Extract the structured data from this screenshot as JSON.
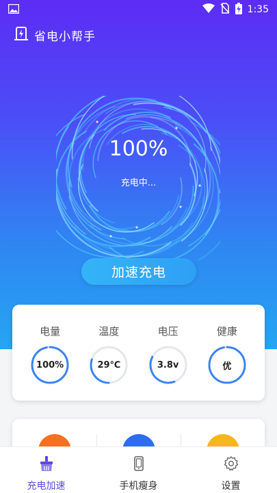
{
  "status_bar": {
    "time": "1:35"
  },
  "app": {
    "title": "省电小帮手"
  },
  "charge": {
    "percent": "100%",
    "status": "充电中..."
  },
  "boost_button": {
    "label": "加速充电"
  },
  "stats": [
    {
      "label": "电量",
      "value": "100%",
      "fraction": 0.97
    },
    {
      "label": "温度",
      "value": "29℃",
      "fraction": 0.3
    },
    {
      "label": "电压",
      "value": "3.8v",
      "fraction": 0.38
    },
    {
      "label": "健康",
      "value": "优",
      "fraction": 0.97
    }
  ],
  "tools": [
    {
      "icon": "rocket-icon",
      "color": "#f6701f"
    },
    {
      "icon": "boost-icon",
      "color": "#2f6df0"
    },
    {
      "icon": "thermometer-icon",
      "color": "#f8b51c"
    }
  ],
  "nav": [
    {
      "label": "充电加速",
      "icon": "broom-icon",
      "active": true
    },
    {
      "label": "手机瘦身",
      "icon": "phone-icon",
      "active": false
    },
    {
      "label": "设置",
      "icon": "gear-icon",
      "active": false
    }
  ],
  "colors": {
    "ring_track": "#e4e6ea",
    "ring_fill": "#3b83f0",
    "active_nav": "#5b4bdc"
  }
}
